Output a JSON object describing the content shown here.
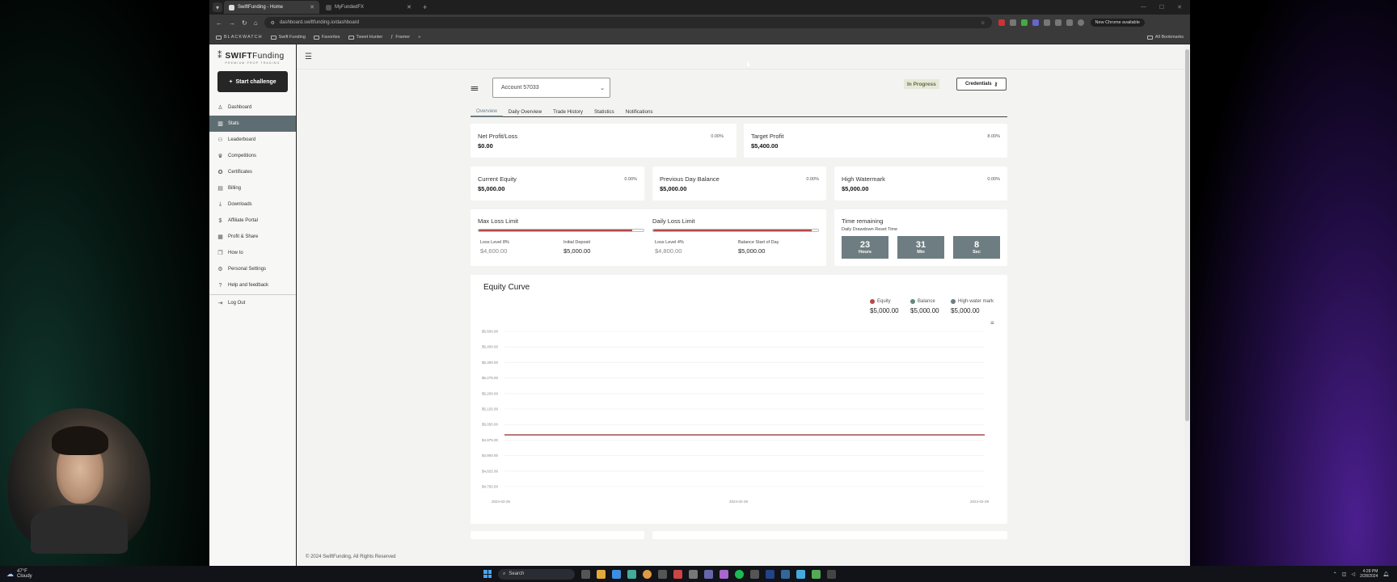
{
  "browser": {
    "tabs": [
      {
        "title": "SwiftFunding - Home",
        "active": true
      },
      {
        "title": "MyFundedFX",
        "active": false
      }
    ],
    "url": "dashboard.swiftfunding.io/dashboard",
    "new_chrome": "New Chrome available",
    "bookmarks": [
      "BLACKWATCH",
      "Swift Funding",
      "Favorites",
      "Tweet Hunter",
      "Framer"
    ],
    "all_bookmarks": "All Bookmarks"
  },
  "brand": {
    "name_bold": "SWIFT",
    "name_light": "Funding",
    "tagline": "PREMIUM PROP TRADING"
  },
  "sidebar": {
    "start_button": "Start challenge",
    "items": [
      {
        "label": "Dashboard",
        "icon": "user-icon",
        "active": false
      },
      {
        "label": "Stats",
        "icon": "stats-icon",
        "active": true
      },
      {
        "label": "Leaderboard",
        "icon": "users-icon",
        "active": false
      },
      {
        "label": "Competitions",
        "icon": "trophy-icon",
        "active": false
      },
      {
        "label": "Certificates",
        "icon": "badge-icon",
        "active": false
      },
      {
        "label": "Billing",
        "icon": "billing-icon",
        "active": false
      },
      {
        "label": "Downloads",
        "icon": "download-icon",
        "active": false
      },
      {
        "label": "Affiliate Portal",
        "icon": "dollar-icon",
        "active": false
      },
      {
        "label": "Profit & Share",
        "icon": "document-icon",
        "active": false
      },
      {
        "label": "How to",
        "icon": "book-icon",
        "active": false
      },
      {
        "label": "Personal Settings",
        "icon": "gear-icon",
        "active": false
      },
      {
        "label": "Help and feedback",
        "icon": "question-icon",
        "active": false
      }
    ],
    "logout": "Log Out"
  },
  "header": {
    "account": "Account 57033",
    "status": "In Progress",
    "credentials": "Credentials"
  },
  "tabs": [
    "Overview",
    "Daily Overview",
    "Trade History",
    "Statistics",
    "Notifications"
  ],
  "cards": {
    "net_profit": {
      "label": "Net Profit/Loss",
      "value": "$0.00",
      "pct": "0.00%"
    },
    "target_profit": {
      "label": "Target Profit",
      "value": "$5,400.00",
      "pct": "8.00%"
    },
    "current_equity": {
      "label": "Current Equity",
      "value": "$5,000.00",
      "pct": "0.00%"
    },
    "prev_day_balance": {
      "label": "Previous Day Balance",
      "value": "$5,000.00",
      "pct": "0.00%"
    },
    "high_watermark": {
      "label": "High Watermark",
      "value": "$5,000.00",
      "pct": "0.00%"
    }
  },
  "limits": {
    "max_loss": {
      "title": "Max Loss Limit",
      "fill": 0.93,
      "loss_level_label": "Loss Level 8%",
      "loss_level_value": "$4,600.00",
      "initial_label": "Initial Deposit",
      "initial_value": "$5,000.00"
    },
    "daily_loss": {
      "title": "Daily Loss Limit",
      "fill": 0.96,
      "loss_level_label": "Loss Level 4%",
      "loss_level_value": "$4,800.00",
      "balance_label": "Balance Start of Day",
      "balance_value": "$5,000.00"
    }
  },
  "time_remaining": {
    "title": "Time remaining",
    "subtitle": "Daily Drawdown Reset Time",
    "hours": "23",
    "hours_label": "Hours",
    "min": "31",
    "min_label": "Min",
    "sec": "8",
    "sec_label": "Sec"
  },
  "footer": "© 2024 SwiftFunding, All Rights Reserved",
  "taskbar": {
    "temp": "47°F",
    "weather": "Cloudy",
    "search": "Search",
    "time": "4:28 PM",
    "date": "2/28/2024"
  },
  "colors": {
    "accent": "#6e7d82",
    "equity": "#b64a4a",
    "balance": "#5e8a7c",
    "hwm": "#6e7d82"
  },
  "chart_data": {
    "type": "line",
    "title": "Equity Curve",
    "x": [
      "2024-02-26",
      "2024-02-28",
      "2024-02-29"
    ],
    "series": [
      {
        "name": "Equity",
        "values": [
          5000,
          5000,
          5000
        ],
        "legend_value": "$5,000.00"
      },
      {
        "name": "Balance",
        "values": [
          5000,
          5000,
          5000
        ],
        "legend_value": "$5,000.00"
      },
      {
        "name": "High-water mark",
        "values": [
          5000,
          5000,
          5000
        ],
        "legend_value": "$5,000.00"
      }
    ],
    "y_ticks": [
      "$5,500.00",
      "$5,400.00",
      "$5,300.00",
      "$5,275.00",
      "$5,200.00",
      "$5,125.00",
      "$5,050.00",
      "$4,975.00",
      "$4,900.00",
      "$4,825.00",
      "$4,750.00"
    ],
    "ylim": [
      4750,
      5500
    ],
    "grid": true,
    "legend": "top-right"
  }
}
